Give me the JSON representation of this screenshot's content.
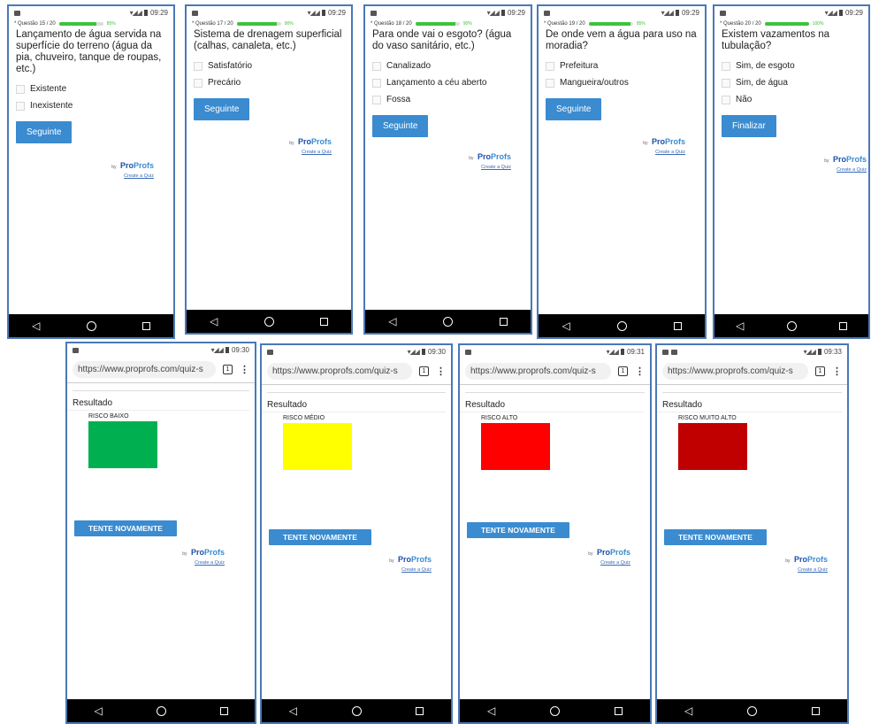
{
  "status": {
    "time": "09:29"
  },
  "quiz_screens": [
    {
      "progress_label": "* Questão 15 / 20",
      "progress_pct": "85%",
      "progress_fraction": 0.85,
      "question": "Lançamento de água servida na superfície do terreno (água da pia, chuveiro, tanque de roupas, etc.)",
      "options": [
        "Existente",
        "Inexistente"
      ],
      "button": "Seguinte"
    },
    {
      "progress_label": "* Questão 17 / 20",
      "progress_pct": "90%",
      "progress_fraction": 0.9,
      "question": "Sistema de drenagem superficial (calhas, canaleta, etc.)",
      "options": [
        "Satisfatório",
        "Precário"
      ],
      "button": "Seguinte"
    },
    {
      "progress_label": "* Questão 18 / 20",
      "progress_pct": "90%",
      "progress_fraction": 0.9,
      "question": "Para onde vai o esgoto? (água do vaso sanitário, etc.)",
      "options": [
        "Canalizado",
        "Lançamento a céu aberto",
        "Fossa"
      ],
      "button": "Seguinte"
    },
    {
      "progress_label": "* Questão 19 / 20",
      "progress_pct": "95%",
      "progress_fraction": 0.95,
      "question": "De onde vem a água para uso na moradia?",
      "options": [
        "Prefeitura",
        "Mangueira/outros"
      ],
      "button": "Seguinte"
    },
    {
      "progress_label": "* Questão 20 / 20",
      "progress_pct": "100%",
      "progress_fraction": 1.0,
      "question": "Existem vazamentos na tubulação?",
      "options": [
        "Sim, de esgoto",
        "Sim, de água",
        "Não"
      ],
      "button": "Finalizar"
    }
  ],
  "result_screens": [
    {
      "time": "09:30",
      "url": "https://www.proprofs.com/quiz-s",
      "tabs": "1",
      "title": "Resultado",
      "risk": "RISCO BAIXO",
      "color": "#00b050",
      "button": "TENTE NOVAMENTE"
    },
    {
      "time": "09:30",
      "url": "https://www.proprofs.com/quiz-s",
      "tabs": "1",
      "title": "Resultado",
      "risk": "RISCO MÉDIO",
      "color": "#ffff00",
      "button": "TENTE NOVAMENTE"
    },
    {
      "time": "09:31",
      "url": "https://www.proprofs.com/quiz-s",
      "tabs": "1",
      "title": "Resultado",
      "risk": "RISCO ALTO",
      "color": "#ff0000",
      "button": "TENTE NOVAMENTE"
    },
    {
      "time": "09:33",
      "url": "https://www.proprofs.com/quiz-s",
      "tabs": "1",
      "title": "Resultado",
      "risk": "RISCO MUITO ALTO",
      "color": "#c00000",
      "button": "TENTE NOVAMENTE"
    }
  ],
  "brand": {
    "by": "by",
    "pro": "Pro",
    "profs": "Profs",
    "create": "Create a Quiz"
  },
  "nav": {
    "back": "◁"
  }
}
